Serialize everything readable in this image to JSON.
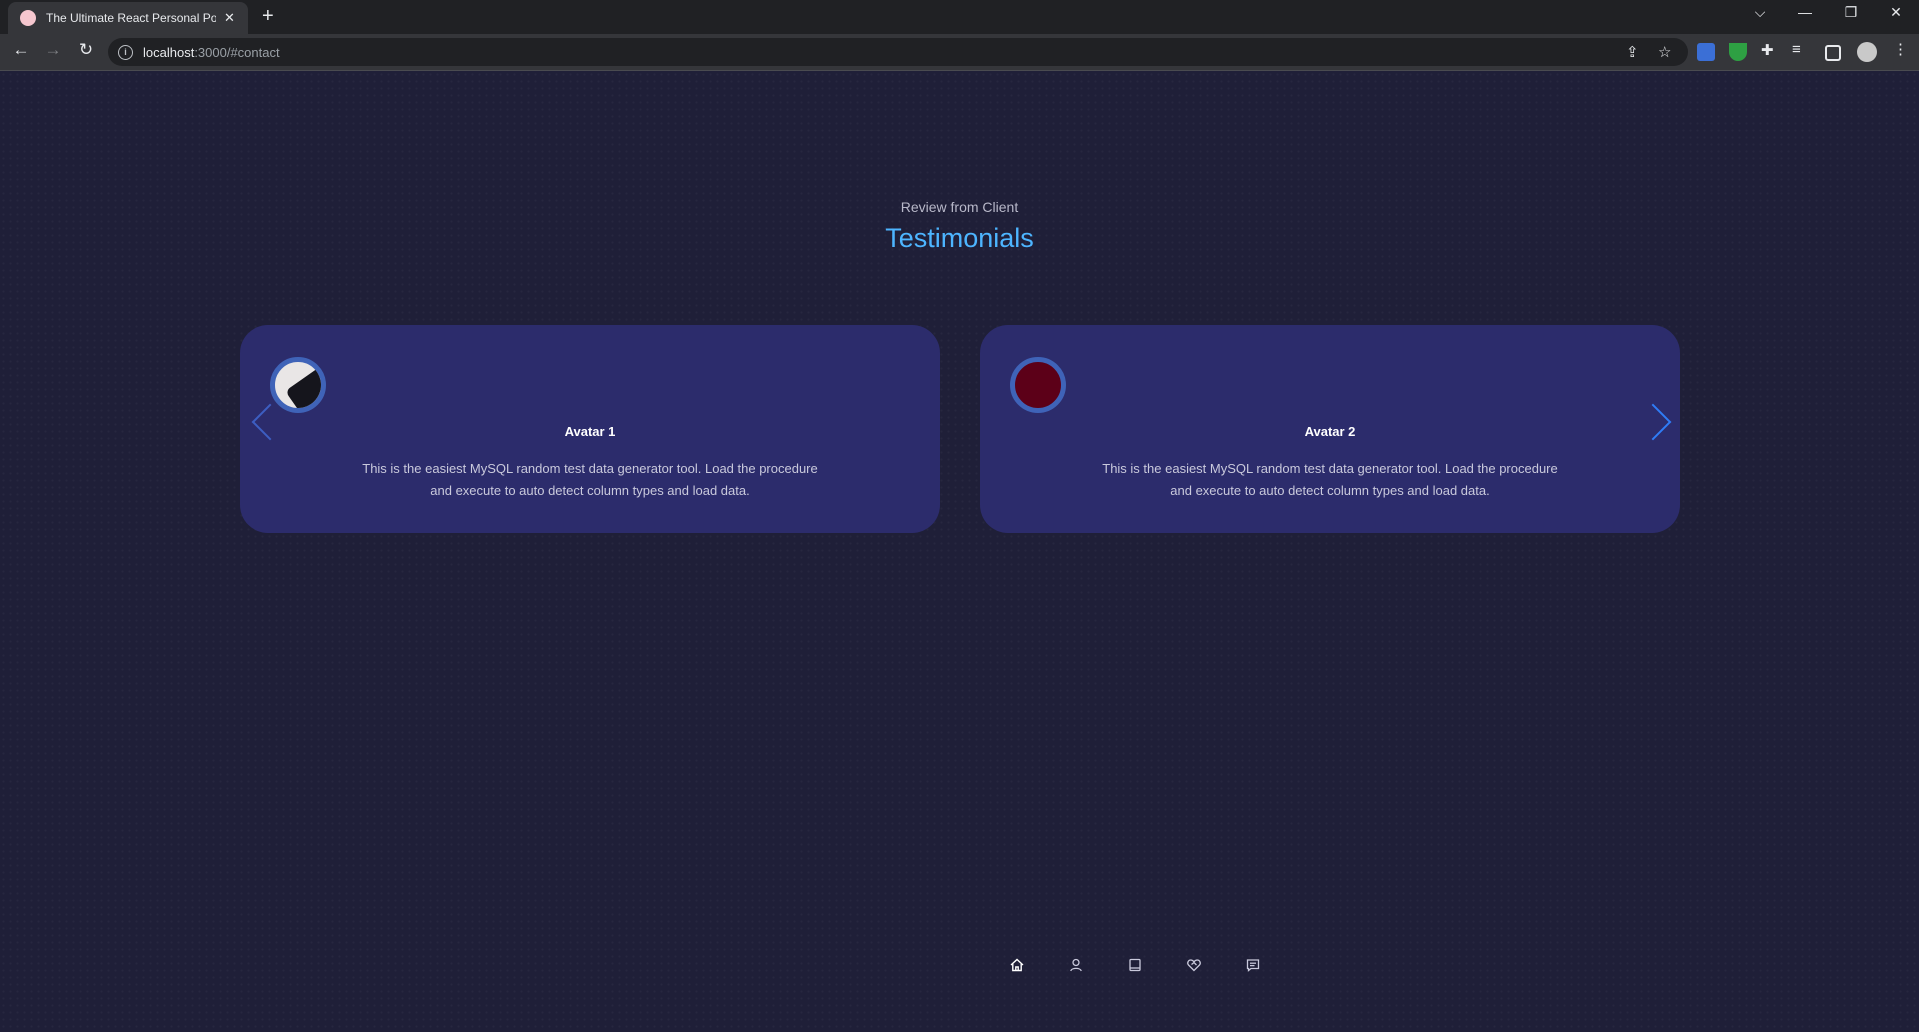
{
  "browser": {
    "tab_title": "The Ultimate React Personal Portf",
    "tab_close": "✕",
    "new_tab": "+",
    "url_host": "localhost",
    "url_path": ":3000/#contact",
    "window_controls": {
      "dropdown": "⌵",
      "minimize": "—",
      "restore": "❐",
      "close": "✕"
    },
    "nav": {
      "back": "←",
      "forward": "→",
      "reload": "↻"
    }
  },
  "section": {
    "subtitle": "Review from Client",
    "title": "Testimonials"
  },
  "testimonials": [
    {
      "name": "Avatar 1",
      "text": "This is the easiest MySQL random test data generator tool. Load the procedure and execute to auto detect column types and load data."
    },
    {
      "name": "Avatar 2",
      "text": "This is the easiest MySQL random test data generator tool. Load the procedure and execute to auto detect column types and load data."
    }
  ],
  "bottom_nav": [
    {
      "icon": "home-icon",
      "active": true
    },
    {
      "icon": "user-icon",
      "active": false
    },
    {
      "icon": "book-icon",
      "active": false
    },
    {
      "icon": "heart-handshake-icon",
      "active": false
    },
    {
      "icon": "message-icon",
      "active": false
    }
  ],
  "colors": {
    "background": "#1f1f38",
    "card": "#2c2c6c",
    "accent": "#4db5ff",
    "avatar_border": "#3f63b8"
  }
}
